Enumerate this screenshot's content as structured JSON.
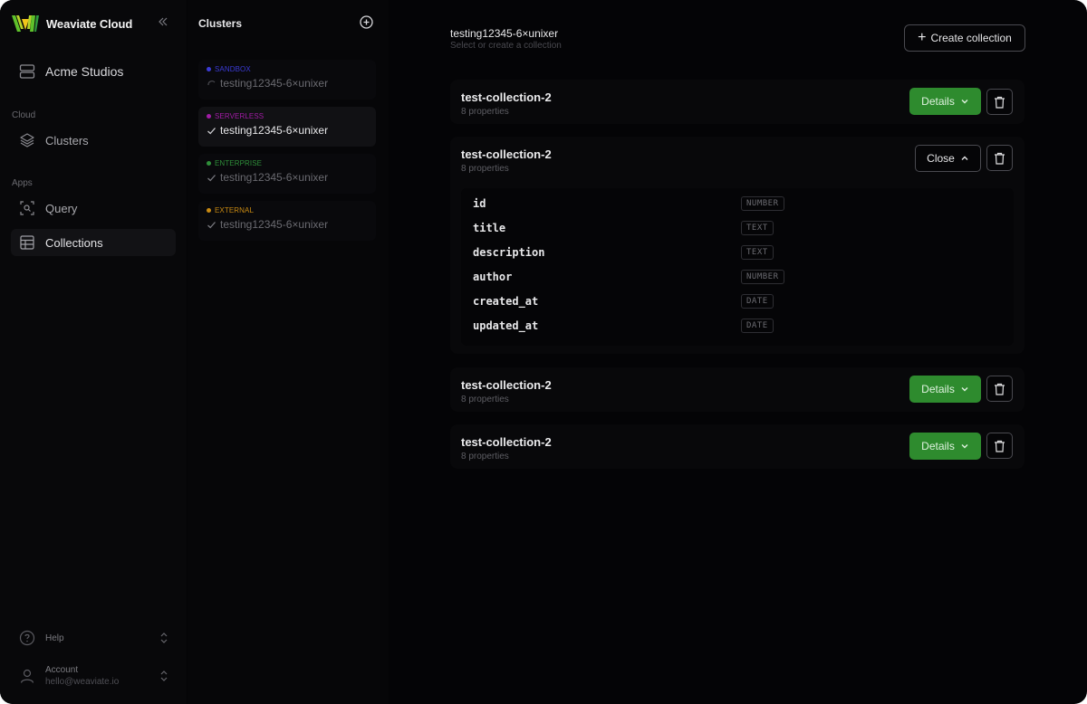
{
  "colors": {
    "sandbox": "#3b3bd6",
    "serverless": "#a21ca6",
    "enterprise": "#2f8f3a",
    "external": "#c98a12",
    "details_button": "#2e8b2e"
  },
  "sidebar": {
    "brand": "Weaviate Cloud",
    "org": "Acme Studios",
    "sections": {
      "cloud": "Cloud",
      "apps": "Apps"
    },
    "items": [
      {
        "label": "Clusters",
        "icon": "layers-icon"
      },
      {
        "label": "Query",
        "icon": "query-icon"
      },
      {
        "label": "Collections",
        "icon": "table-icon",
        "active": true
      }
    ],
    "help": {
      "label": "Help",
      "icon": "help-circle-icon"
    },
    "account": {
      "label": "Account",
      "email": "hello@weaviate.io",
      "icon": "user-icon"
    }
  },
  "clusters": {
    "title": "Clusters",
    "list": [
      {
        "type": "SANDBOX",
        "name": "testing12345-6×unixer",
        "status": "loading-icon"
      },
      {
        "type": "SERVERLESS",
        "name": "testing12345-6×unixer",
        "status": "check-icon",
        "active": true
      },
      {
        "type": "ENTERPRISE",
        "name": "testing12345-6×unixer",
        "status": "check-icon"
      },
      {
        "type": "EXTERNAL",
        "name": "testing12345-6×unixer",
        "status": "check-icon"
      }
    ]
  },
  "main": {
    "title": "testing12345-6×unixer",
    "subtitle": "Select or create a collection",
    "create_label": "Create collection",
    "collections": [
      {
        "name": "test-collection-2",
        "props": "8 properties",
        "button": "Details",
        "expanded": false
      },
      {
        "name": "test-collection-2",
        "props": "8 properties",
        "button": "Close",
        "expanded": true,
        "properties": [
          {
            "name": "id",
            "type": "NUMBER"
          },
          {
            "name": "title",
            "type": "TEXT"
          },
          {
            "name": "description",
            "type": "TEXT"
          },
          {
            "name": "author",
            "type": "NUMBER"
          },
          {
            "name": "created_at",
            "type": "DATE"
          },
          {
            "name": "updated_at",
            "type": "DATE"
          }
        ]
      },
      {
        "name": "test-collection-2",
        "props": "8 properties",
        "button": "Details",
        "expanded": false
      },
      {
        "name": "test-collection-2",
        "props": "8 properties",
        "button": "Details",
        "expanded": false
      }
    ]
  }
}
